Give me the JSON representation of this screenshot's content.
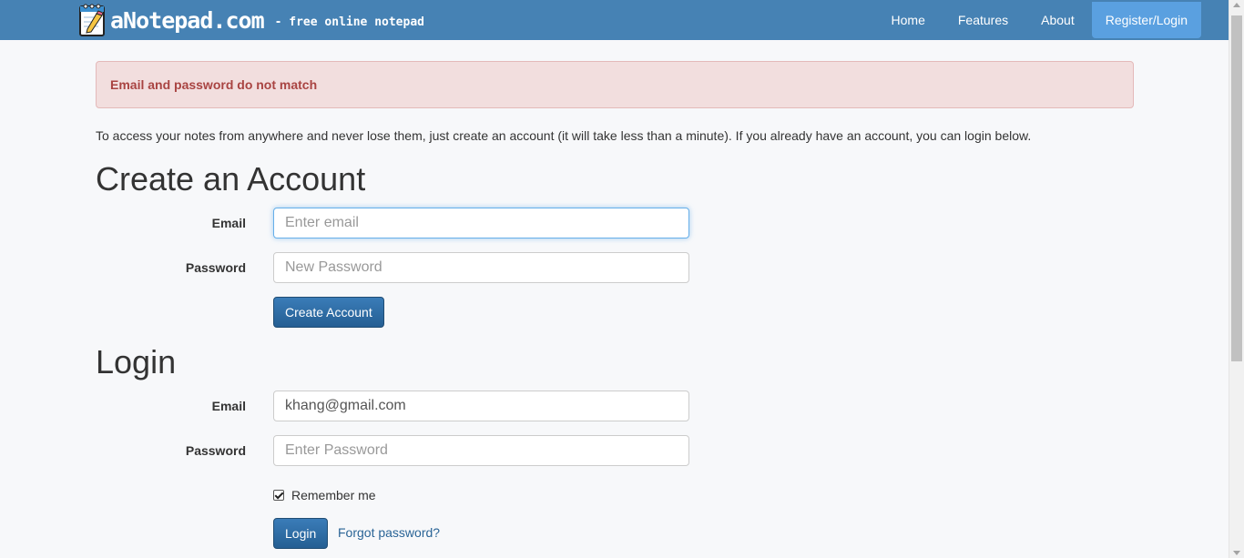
{
  "header": {
    "brand_name": "aNotepad.com",
    "brand_tagline": "- free online notepad",
    "nav": [
      "Home",
      "Features",
      "About",
      "Register/Login"
    ],
    "active_nav": "Register/Login"
  },
  "alert": {
    "message": "Email and password do not match"
  },
  "intro": "To access your notes from anywhere and never lose them, just create an account (it will take less than a minute). If you already have an account, you can login below.",
  "create_account": {
    "title": "Create an Account",
    "email_label": "Email",
    "email_placeholder": "Enter email",
    "email_value": "",
    "password_label": "Password",
    "password_placeholder": "New Password",
    "button": "Create Account"
  },
  "login": {
    "title": "Login",
    "email_label": "Email",
    "email_value": "khang@gmail.com",
    "password_label": "Password",
    "password_placeholder": "Enter Password",
    "remember_label": "Remember me",
    "remember_checked": true,
    "button": "Login",
    "forgot": "Forgot password?"
  },
  "colors": {
    "navbar": "#4682b4",
    "active_nav": "#5aa0e0",
    "alert_bg": "#f2dede",
    "alert_text": "#a94442",
    "button": "#2e6da4",
    "link": "#2a6496"
  },
  "icons": {
    "brand": "notepad-pencil-icon",
    "checkbox": "checkmark-icon"
  }
}
